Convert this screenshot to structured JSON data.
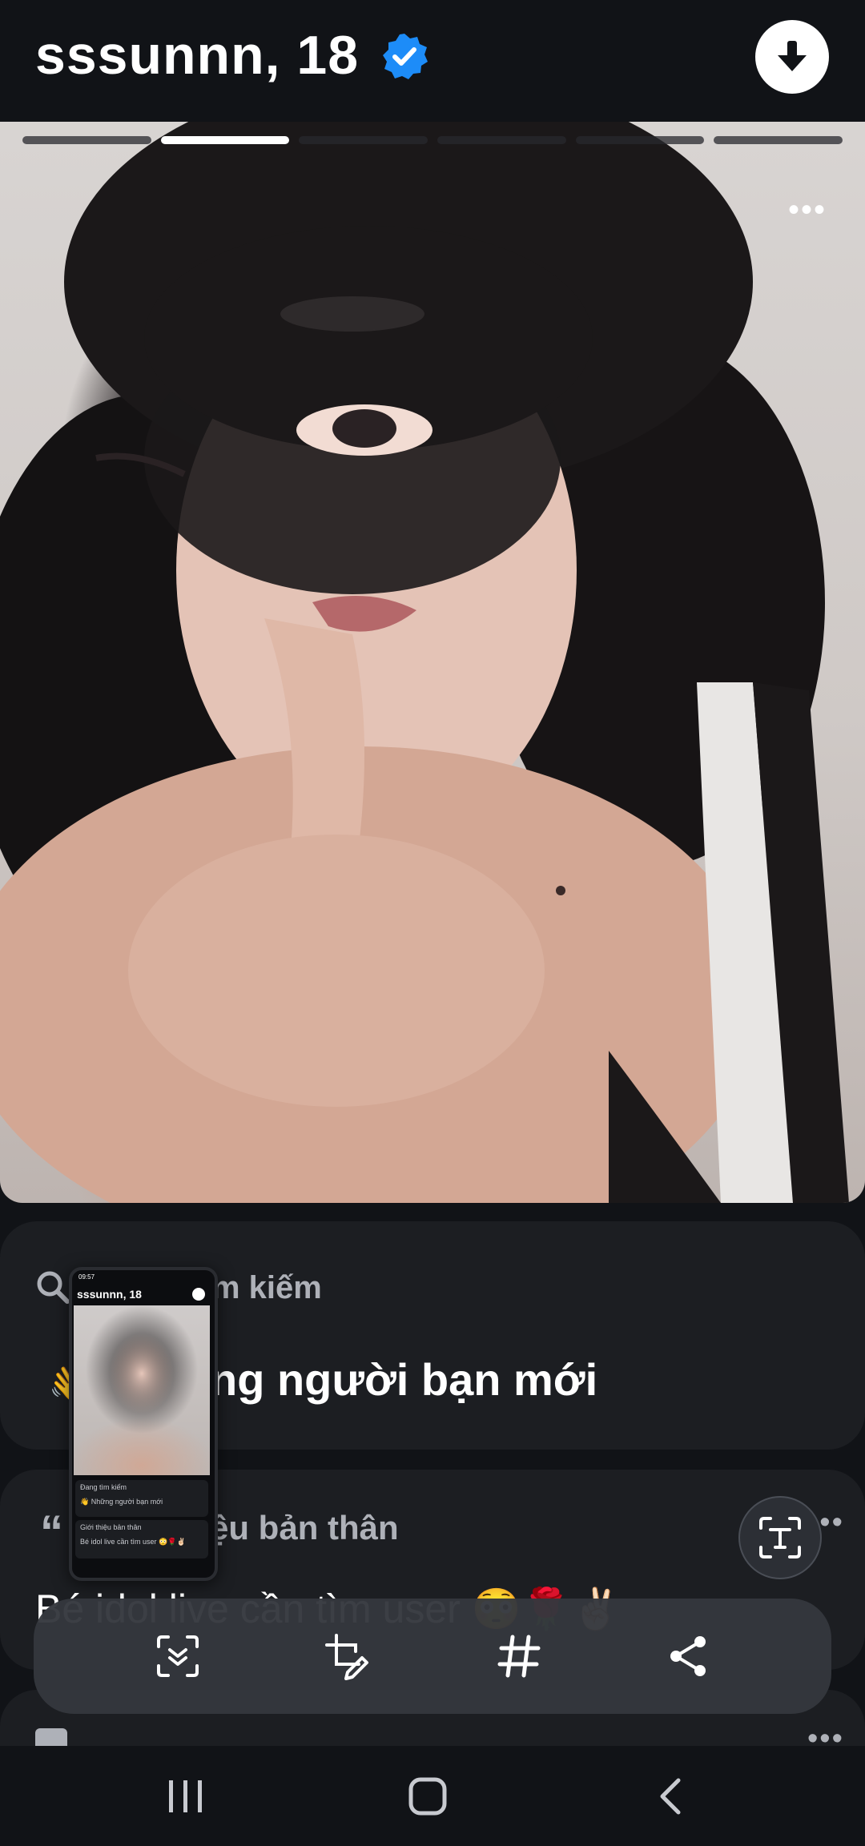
{
  "header": {
    "name": "sssunnn, 18",
    "verified_icon": "verified-badge-icon",
    "download_icon": "download-arrow-icon"
  },
  "photo": {
    "segments": 6,
    "active_segment": 2,
    "more_label": "•••"
  },
  "search_card": {
    "title": "m kiếm",
    "subtitle": "ng người bạn mới",
    "emoji": "👋"
  },
  "bio_card": {
    "title": "ệu bản thân",
    "quote_mark": "“",
    "more_label": "•••",
    "bio": "Bé idol live cần tìm user 😳🌹✌🏻"
  },
  "third_card": {
    "more_label": "•••"
  },
  "thumbnail": {
    "status": "09:57",
    "name": "sssunnn, 18",
    "line1": "Đang tìm kiếm",
    "line2": "👋 Những người bạn mới",
    "line3": "Giới thiệu bản thân",
    "line4": "Bé idol live cần tìm user 😳🌹✌🏻"
  },
  "toolbar": {
    "items": [
      "scan-capture-icon",
      "crop-edit-icon",
      "hashtag-icon",
      "share-icon"
    ]
  },
  "colors": {
    "background": "#111317",
    "card": "#1c1e22",
    "verified": "#1d8cf8",
    "muted_text": "#aeb1b8"
  }
}
